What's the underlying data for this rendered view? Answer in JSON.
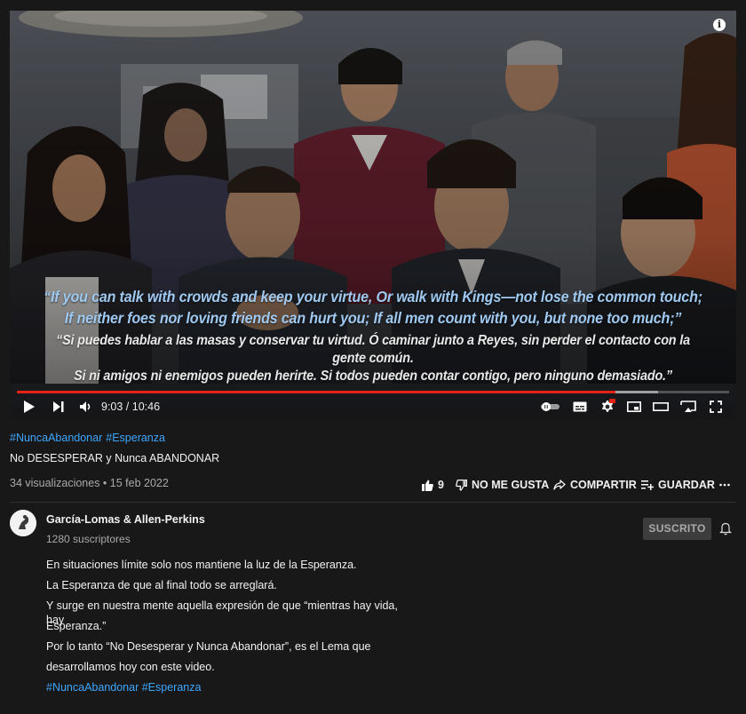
{
  "video": {
    "subtitle_en_1": "“If you can talk with crowds and keep your virtue, Or walk with Kings—not lose the common touch;",
    "subtitle_en_2": "If neither foes nor loving friends can hurt you; If all men count with you, but none too much;”",
    "subtitle_es_1": "“Si puedes hablar a las masas y conservar tu virtud. Ó caminar junto a Reyes, sin perder el contacto con la gente común.",
    "subtitle_es_2": "Si ni amigos ni enemigos pueden herirte. Si todos pueden contar contigo, pero ninguno demasiado.”",
    "time_display": "9:03 / 10:46",
    "progress_played": 0.84,
    "progress_buffered": 0.9,
    "icons": [
      "info-icon",
      "play-icon",
      "next-icon",
      "volume-icon",
      "autoplay-toggle-icon",
      "subtitles-icon",
      "settings-icon",
      "miniplayer-icon",
      "theater-mode-icon",
      "cast-icon",
      "fullscreen-icon"
    ],
    "settings_badge": "HD"
  },
  "info": {
    "hashtag_1": "#NuncaAbandonar",
    "hashtag_2": "#Esperanza",
    "title": "No DESESPERAR y Nunca ABANDONAR",
    "views_date": "34 visualizaciones • 15 feb 2022",
    "like_count": "9",
    "dislike_label": "NO ME GUSTA",
    "share_label": "COMPARTIR",
    "save_label": "GUARDAR"
  },
  "channel": {
    "name": "García-Lomas & Allen-Perkins",
    "subscribers": "1280 suscriptores",
    "subscribe_label": "SUSCRITO"
  },
  "description": {
    "lines": [
      "En situaciones límite solo nos mantiene la luz de la Esperanza.",
      "La Esperanza de que al final todo se arreglará.",
      "Y surge en nuestra mente aquella expresión de que “mientras hay vida, hay",
      "Esperanza.”",
      "Por lo tanto “No Desesperar y Nunca Abandonar”, es el Lema que",
      "desarrollamos hoy con este video."
    ],
    "hashtags": "#NuncaAbandonar #Esperanza"
  },
  "colors": {
    "background": "#181818",
    "link": "#3ea6ff",
    "progress": "#e62117"
  }
}
